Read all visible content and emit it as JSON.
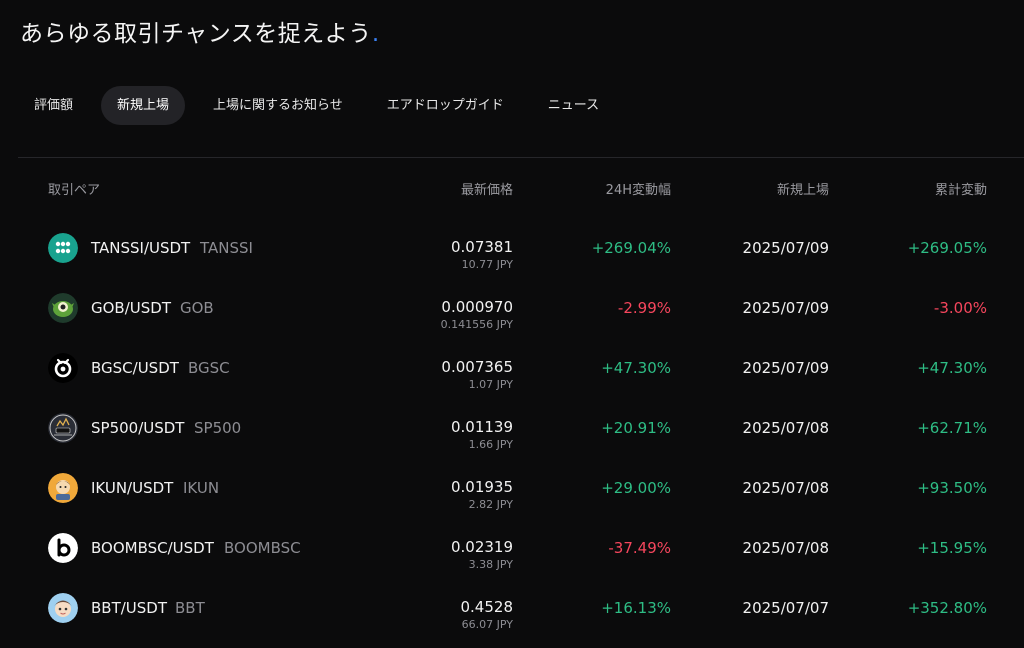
{
  "headline": {
    "text": "あらゆる取引チャンスを捉えよう",
    "dot": "."
  },
  "tabs": [
    {
      "label": "評価額",
      "active": false
    },
    {
      "label": "新規上場",
      "active": true
    },
    {
      "label": "上場に関するお知らせ",
      "active": false
    },
    {
      "label": "エアドロップガイド",
      "active": false
    },
    {
      "label": "ニュース",
      "active": false
    }
  ],
  "table": {
    "headers": {
      "pair": "取引ペア",
      "price": "最新価格",
      "change_24h": "24H変動幅",
      "listed": "新規上場",
      "cumulative": "累計変動"
    },
    "rows": [
      {
        "pair": "TANSSI/USDT",
        "base": "TANSSI",
        "price": "0.07381",
        "price_jpy": "10.77 JPY",
        "change": "+269.04%",
        "change_dir": "up",
        "date": "2025/07/09",
        "cum": "+269.05%",
        "cum_dir": "up",
        "icon": "tanssi-icon"
      },
      {
        "pair": "GOB/USDT",
        "base": "GOB",
        "price": "0.000970",
        "price_jpy": "0.141556 JPY",
        "change": "-2.99%",
        "change_dir": "down",
        "date": "2025/07/09",
        "cum": "-3.00%",
        "cum_dir": "down",
        "icon": "gob-icon"
      },
      {
        "pair": "BGSC/USDT",
        "base": "BGSC",
        "price": "0.007365",
        "price_jpy": "1.07 JPY",
        "change": "+47.30%",
        "change_dir": "up",
        "date": "2025/07/09",
        "cum": "+47.30%",
        "cum_dir": "up",
        "icon": "bgsc-icon"
      },
      {
        "pair": "SP500/USDT",
        "base": "SP500",
        "price": "0.01139",
        "price_jpy": "1.66 JPY",
        "change": "+20.91%",
        "change_dir": "up",
        "date": "2025/07/08",
        "cum": "+62.71%",
        "cum_dir": "up",
        "icon": "sp500-icon"
      },
      {
        "pair": "IKUN/USDT",
        "base": "IKUN",
        "price": "0.01935",
        "price_jpy": "2.82 JPY",
        "change": "+29.00%",
        "change_dir": "up",
        "date": "2025/07/08",
        "cum": "+93.50%",
        "cum_dir": "up",
        "icon": "ikun-icon"
      },
      {
        "pair": "BOOMBSC/USDT",
        "base": "BOOMBSC",
        "price": "0.02319",
        "price_jpy": "3.38 JPY",
        "change": "-37.49%",
        "change_dir": "down",
        "date": "2025/07/08",
        "cum": "+15.95%",
        "cum_dir": "up",
        "icon": "boombsc-icon"
      },
      {
        "pair": "BBT/USDT",
        "base": "BBT",
        "price": "0.4528",
        "price_jpy": "66.07 JPY",
        "change": "+16.13%",
        "change_dir": "up",
        "date": "2025/07/07",
        "cum": "+352.80%",
        "cum_dir": "up",
        "icon": "bbt-icon"
      }
    ]
  },
  "colors": {
    "up": "#2ebd85",
    "down": "#f6465d",
    "accent": "#3b82f6",
    "background": "#0b0b0c"
  }
}
